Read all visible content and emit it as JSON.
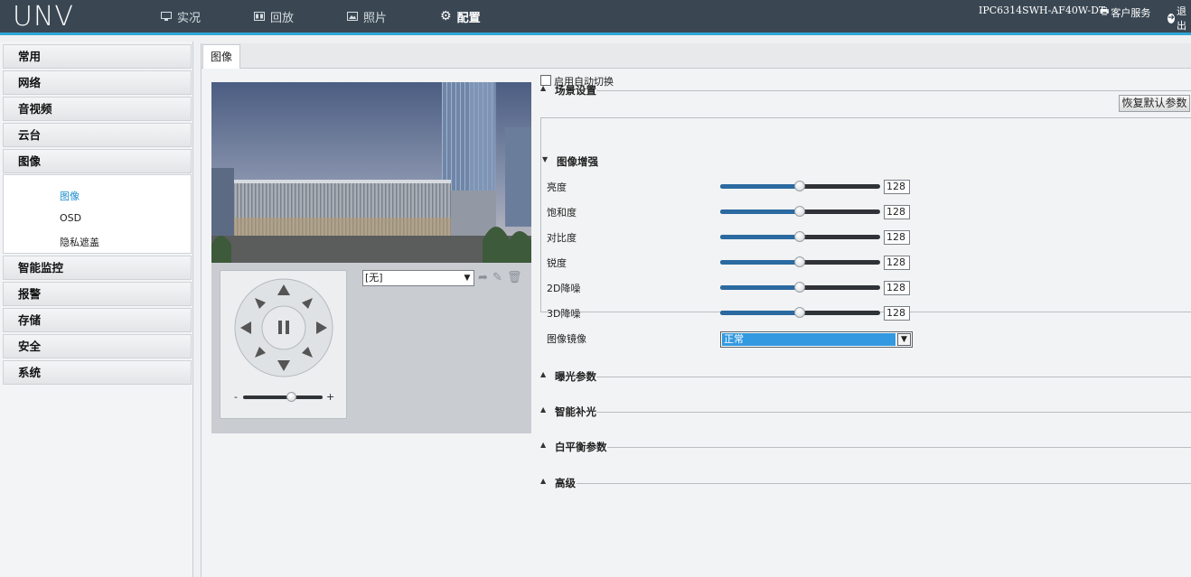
{
  "brand": {
    "logo": "UNV"
  },
  "nav": {
    "items": [
      {
        "label": "实况",
        "icon": "monitor-icon"
      },
      {
        "label": "回放",
        "icon": "playback-icon"
      },
      {
        "label": "照片",
        "icon": "photo-icon"
      },
      {
        "label": "配置",
        "icon": "gear-icon"
      }
    ],
    "active": "配置"
  },
  "header": {
    "device_name": "IPC6314SWH-AF40W-DT",
    "customer_service": "客户服务",
    "logout": "退出"
  },
  "sidebar": {
    "items": [
      {
        "label": "常用"
      },
      {
        "label": "网络"
      },
      {
        "label": "音视频"
      },
      {
        "label": "云台"
      },
      {
        "label": "图像"
      },
      {
        "label": "智能监控"
      },
      {
        "label": "报警"
      },
      {
        "label": "存储"
      },
      {
        "label": "安全"
      },
      {
        "label": "系统"
      }
    ],
    "submenu": [
      {
        "label": "图像",
        "active": true
      },
      {
        "label": "OSD"
      },
      {
        "label": "隐私遮盖"
      }
    ]
  },
  "tab": {
    "label": "图像"
  },
  "ptz": {
    "preset": "[无]",
    "zoom_minus": "-",
    "zoom_plus": "+",
    "zoom_level": 0.65
  },
  "sections": {
    "scene": "场景设置",
    "enhance": "图像增强",
    "exposure": "曝光参数",
    "smart_light": "智能补光",
    "white_balance": "白平衡参数",
    "advanced": "高级"
  },
  "scene": {
    "auto_switch_label": "启用自动切换",
    "auto_switch_checked": false
  },
  "restore_button": "恢复默认参数",
  "enhance": {
    "params": [
      {
        "label": "亮度",
        "value": "128"
      },
      {
        "label": "饱和度",
        "value": "128"
      },
      {
        "label": "对比度",
        "value": "128"
      },
      {
        "label": "锐度",
        "value": "128"
      },
      {
        "label": "2D降噪",
        "value": "128"
      },
      {
        "label": "3D降噪",
        "value": "128"
      }
    ],
    "max": 255,
    "mirror_label": "图像镜像",
    "mirror_value": "正常"
  },
  "colors": {
    "accent": "#2ea6d6",
    "topbar": "#3a4753",
    "select_highlight": "#3399e0"
  }
}
